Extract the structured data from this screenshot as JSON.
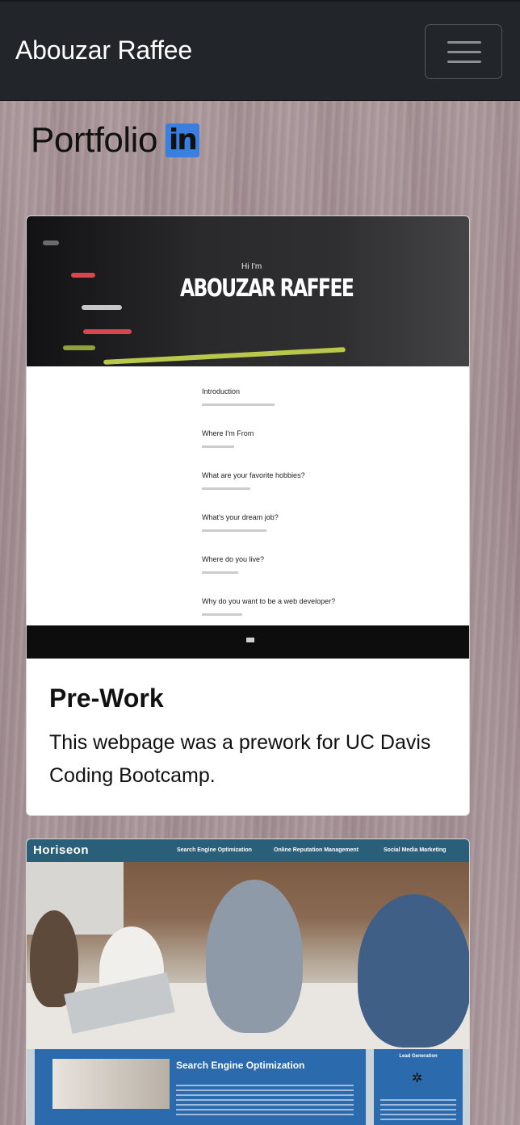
{
  "navbar": {
    "brand": "Abouzar Raffee",
    "toggler_icon": "hamburger-icon"
  },
  "page": {
    "heading": "Portfolio",
    "heading_icon": "linkedin-icon",
    "linkedin_glyph": "in"
  },
  "projects": [
    {
      "title": "Pre-Work",
      "description": "This webpage was a prework for UC Davis Coding Bootcamp.",
      "screenshot": {
        "greeting": "Hi I'm",
        "name": "ABOUZAR RAFFEE",
        "questions": [
          "Introduction",
          "Where I'm From",
          "What are your favorite hobbies?",
          "What's your dream job?",
          "Where do you live?",
          "Why do you want to be a web developer?"
        ]
      }
    },
    {
      "screenshot": {
        "logo": "Horiseon",
        "nav": [
          "Search Engine Optimization",
          "Online Reputation Management",
          "Social Media Marketing"
        ],
        "section_title": "Search Engine Optimization",
        "side_title": "Lead Generation"
      }
    }
  ],
  "colors": {
    "navbar_bg": "#22252a",
    "linkedin_blue": "#3a7fe0",
    "horiseon_header": "#2a5f7a",
    "horiseon_section": "#2b6aad"
  }
}
